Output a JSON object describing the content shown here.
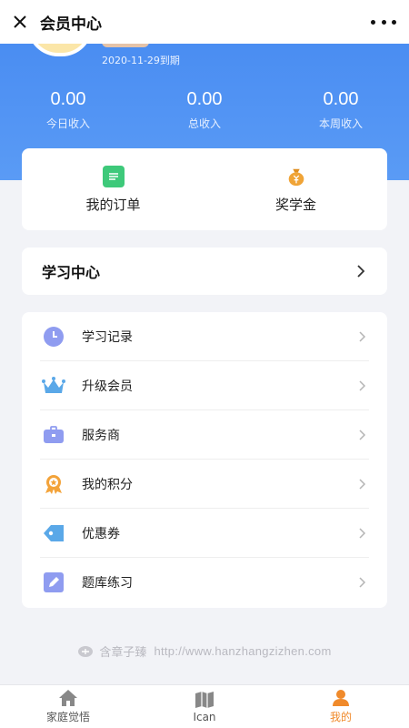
{
  "header": {
    "title": "会员中心"
  },
  "profile": {
    "expiry": "2020-11-29到期"
  },
  "stats": [
    {
      "value": "0.00",
      "label": "今日收入"
    },
    {
      "value": "0.00",
      "label": "总收入"
    },
    {
      "value": "0.00",
      "label": "本周收入"
    }
  ],
  "quick_links": [
    {
      "label": "我的订单",
      "icon": "order-icon",
      "color": "#3ec97a"
    },
    {
      "label": "奖学金",
      "icon": "money-bag-icon",
      "color": "#f0a437"
    }
  ],
  "study_center": {
    "title": "学习中心"
  },
  "menu": [
    {
      "label": "学习记录",
      "icon": "clock-icon"
    },
    {
      "label": "升级会员",
      "icon": "crown-icon"
    },
    {
      "label": "服务商",
      "icon": "briefcase-icon"
    },
    {
      "label": "我的积分",
      "icon": "medal-icon"
    },
    {
      "label": "优惠券",
      "icon": "tag-icon"
    },
    {
      "label": "题库练习",
      "icon": "edit-icon"
    }
  ],
  "footer": {
    "brand": "含章子臻",
    "url": "http://www.hanzhangzizhen.com"
  },
  "tabs": [
    {
      "label": "家庭觉悟",
      "icon": "home-icon"
    },
    {
      "label": "Ican",
      "icon": "book-icon"
    },
    {
      "label": "我的",
      "icon": "user-icon"
    }
  ],
  "colors": {
    "accent": "#4a8df2",
    "active_tab": "#f08a2b"
  }
}
